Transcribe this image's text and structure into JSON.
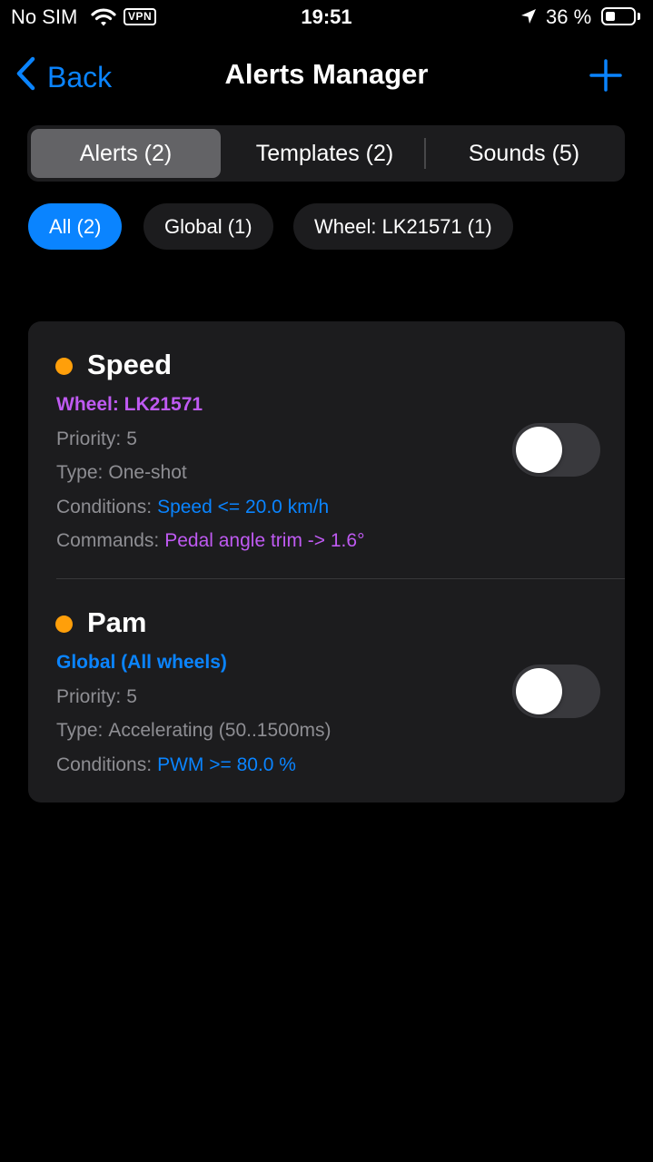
{
  "status_bar": {
    "carrier": "No SIM",
    "vpn": "VPN",
    "time": "19:51",
    "battery": "36 %"
  },
  "nav": {
    "back_label": "Back",
    "title": "Alerts Manager",
    "add_icon": "plus-icon"
  },
  "segments": [
    {
      "label": "Alerts (2)",
      "active": true
    },
    {
      "label": "Templates (2)",
      "active": false
    },
    {
      "label": "Sounds (5)",
      "active": false
    }
  ],
  "filters": [
    {
      "label": "All (2)",
      "active": true
    },
    {
      "label": "Global (1)",
      "active": false
    },
    {
      "label": "Wheel: LK21571 (1)",
      "active": false
    }
  ],
  "alerts": [
    {
      "name": "Speed",
      "scope": "Wheel: LK21571",
      "priority_label": "Priority:",
      "priority": "5",
      "type_label": "Type:",
      "type": "One-shot",
      "conditions_label": "Conditions:",
      "conditions": "Speed <= 20.0 km/h",
      "commands_label": "Commands:",
      "commands": "Pedal angle trim -> 1.6°",
      "enabled": false
    },
    {
      "name": "Pam",
      "scope": "Global (All wheels)",
      "priority_label": "Priority:",
      "priority": "5",
      "type_label": "Type:",
      "type": "Accelerating (50..1500ms)",
      "conditions_label": "Conditions:",
      "conditions": "PWM >= 80.0 %",
      "enabled": false
    }
  ],
  "colors": {
    "accent": "#0a84ff",
    "wheel_scope": "#bf5af2",
    "global_scope": "#0a84ff",
    "alert_dot": "#ff9f0a",
    "condition": "#0a84ff",
    "command": "#bf5af2"
  }
}
